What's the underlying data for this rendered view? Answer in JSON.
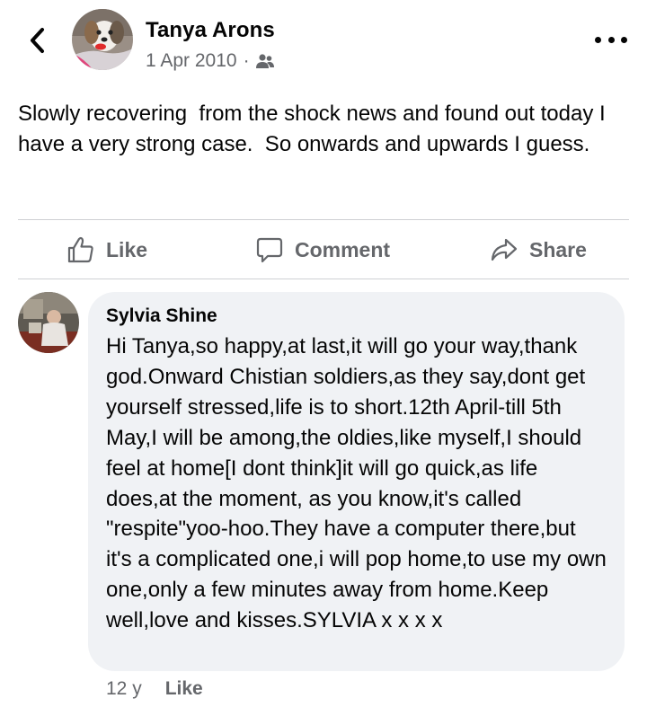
{
  "post": {
    "author": "Tanya Arons",
    "date": "1 Apr 2010",
    "separator": "·",
    "audience_icon": "friends-icon",
    "text": "Slowly recovering  from the shock news and found out today I have a very strong case.  So onwards and upwards I guess."
  },
  "actions": {
    "like": "Like",
    "comment": "Comment",
    "share": "Share"
  },
  "comment": {
    "author": "Sylvia Shine",
    "text": "Hi Tanya,so happy,at last,it will go your way,thank god.Onward Chistian soldiers,as they say,dont get yourself stressed,life is to short.12th April-till 5th May,I will be among,the oldies,like myself,I should feel at home[I dont think]it will go quick,as life does,at the moment, as you know,it's called \"respite\"yoo-hoo.They have a computer there,but it's a complicated one,i will pop home,to use my own one,only a few minutes away from home.Keep well,love and kisses.SYLVIA x x x x",
    "age": "12 y",
    "like_label": "Like"
  },
  "colors": {
    "text": "#050505",
    "secondary": "#65676b",
    "bubble": "#f0f2f5",
    "divider": "#ced0d4"
  }
}
